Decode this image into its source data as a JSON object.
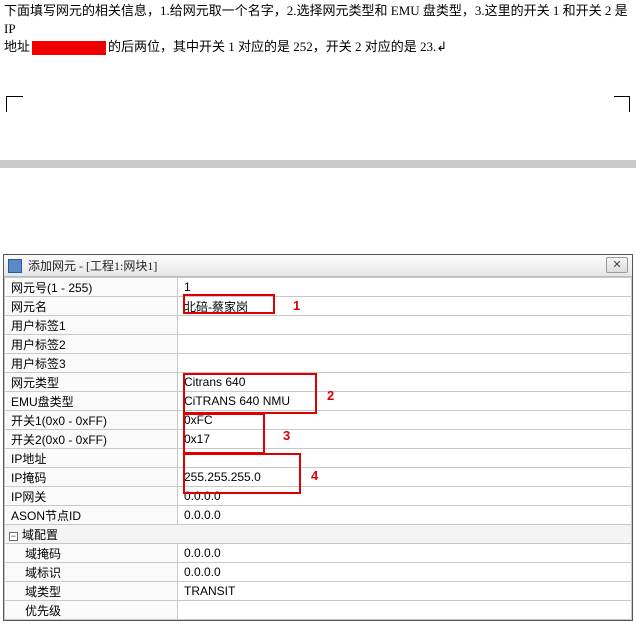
{
  "instructions": {
    "line1_a": "下面填写网元的相关信息，1.给网元取一个名字，2.选择网元类型和 EMU 盘类型，3.这里的开关 1 和开关 2 是 IP",
    "line2_a": "地址",
    "line2_b": "的后两位，其中开关 1 对应的是 252，开关 2 对应的是 23.↲"
  },
  "dialog": {
    "title": "添加网元 - [工程1:网块1]",
    "close": "✕"
  },
  "rows": [
    {
      "label": "网元号(1 - 255)",
      "value": "1"
    },
    {
      "label": "网元名",
      "value": "北碚-蔡家岗"
    },
    {
      "label": "用户标签1",
      "value": ""
    },
    {
      "label": "用户标签2",
      "value": ""
    },
    {
      "label": "用户标签3",
      "value": ""
    },
    {
      "label": "网元类型",
      "value": "Citrans 640"
    },
    {
      "label": "EMU盘类型",
      "value": "CiTRANS 640 NMU"
    },
    {
      "label": "开关1(0x0 - 0xFF)",
      "value": "0xFC"
    },
    {
      "label": "开关2(0x0 - 0xFF)",
      "value": "0x17"
    },
    {
      "label": "IP地址",
      "value": ""
    },
    {
      "label": "IP掩码",
      "value": "255.255.255.0"
    },
    {
      "label": "IP网关",
      "value": "0.0.0.0"
    },
    {
      "label": "ASON节点ID",
      "value": "0.0.0.0"
    }
  ],
  "section": {
    "expand": "−",
    "title": "域配置"
  },
  "rows2": [
    {
      "label": "域掩码",
      "value": "0.0.0.0"
    },
    {
      "label": "域标识",
      "value": "0.0.0.0"
    },
    {
      "label": "域类型",
      "value": "TRANSIT"
    },
    {
      "label": "优先级",
      "value": ""
    }
  ],
  "annotations": {
    "n1": "1",
    "n2": "2",
    "n3": "3",
    "n4": "4"
  }
}
